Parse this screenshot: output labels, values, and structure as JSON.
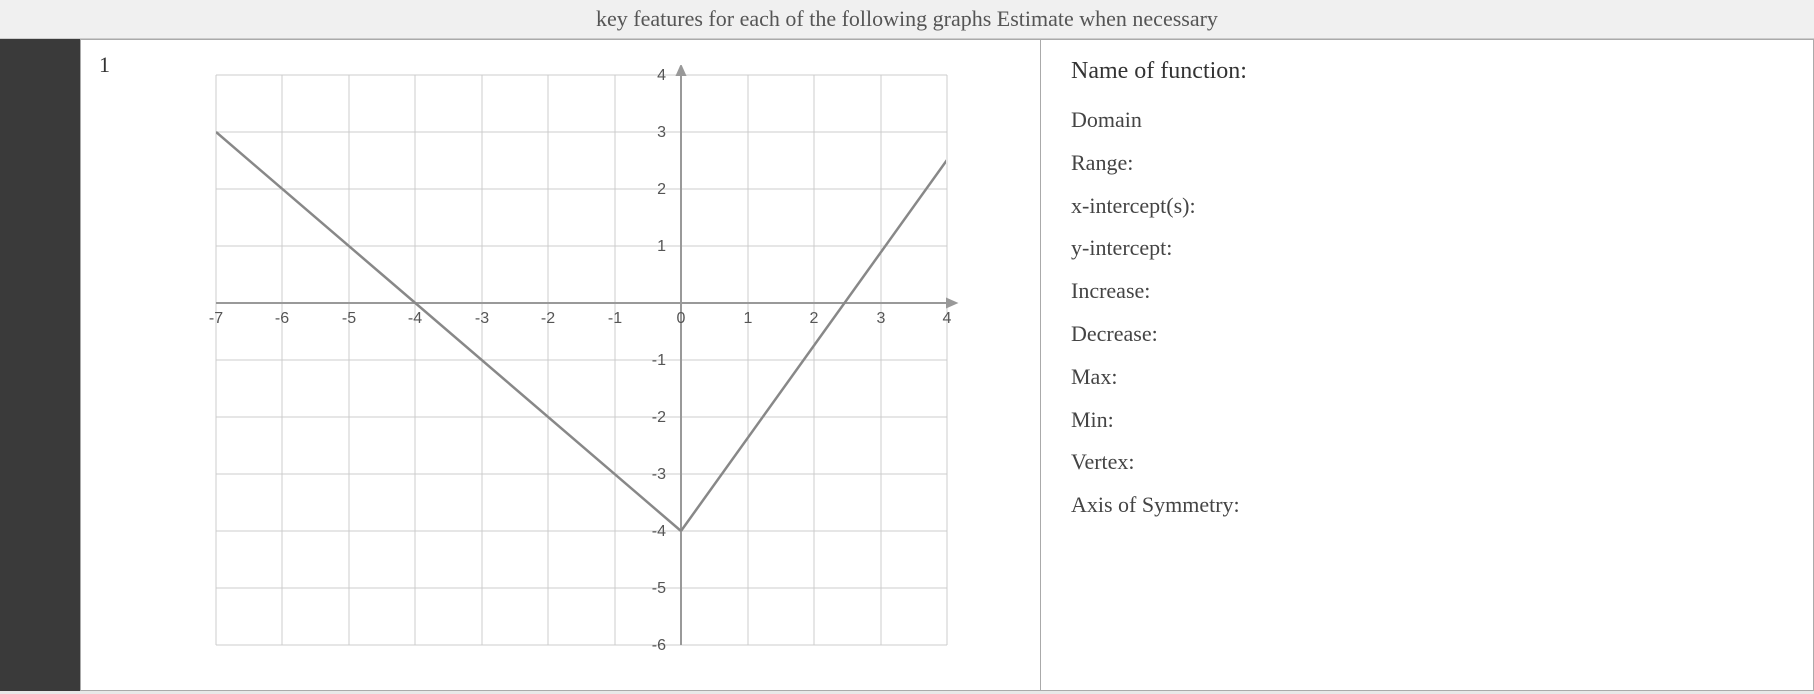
{
  "topbar": {
    "text": "key features for each of the following graphs   Estimate when necessary"
  },
  "problem": {
    "number": "1",
    "info": {
      "title": "Name of function:",
      "fields": [
        {
          "label": "Domain"
        },
        {
          "label": "Range:"
        },
        {
          "label": "x-intercept(s):"
        },
        {
          "label": "y-intercept:"
        },
        {
          "label": "Increase:"
        },
        {
          "label": "Decrease:"
        },
        {
          "label": "Max:"
        },
        {
          "label": "Min:"
        },
        {
          "label": "Vertex:"
        },
        {
          "label": "Axis of Symmetry:"
        }
      ]
    },
    "graph": {
      "xMin": -7,
      "xMax": 4,
      "yMin": -6,
      "yMax": 4,
      "xLabels": [
        -7,
        -6,
        -5,
        -4,
        -3,
        -2,
        -1,
        0,
        1,
        2,
        3,
        4
      ],
      "yLabels": [
        4,
        3,
        2,
        1,
        -1,
        -2,
        -3,
        -4,
        -5,
        -6
      ]
    }
  }
}
